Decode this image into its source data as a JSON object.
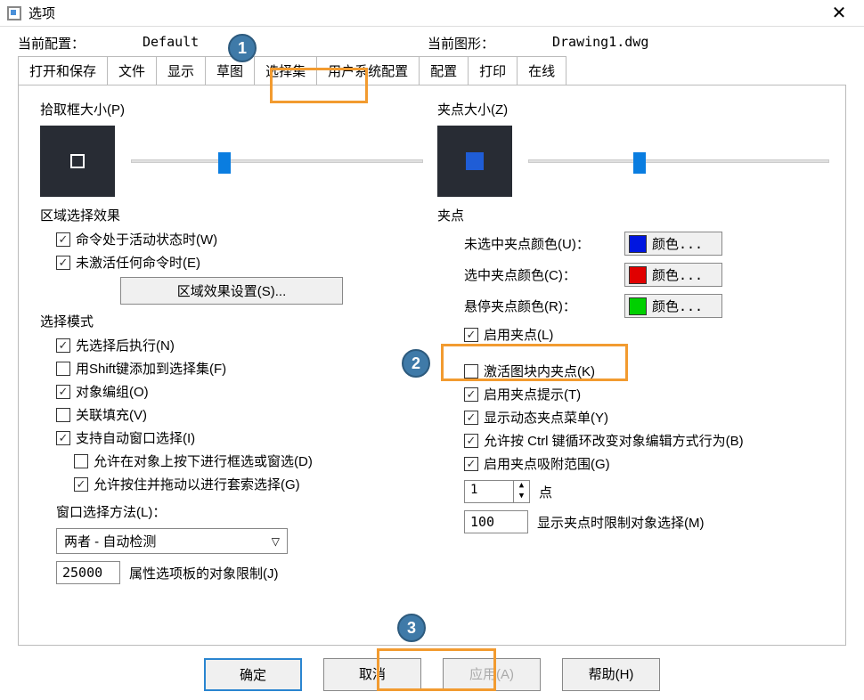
{
  "window": {
    "title": "选项",
    "close": "✕"
  },
  "config": {
    "label_current_config": "当前配置：",
    "current_config": "Default",
    "label_current_drawing": "当前图形：",
    "current_drawing": "Drawing1.dwg"
  },
  "tabs": [
    "打开和保存",
    "文件",
    "显示",
    "草图",
    "选择集",
    "用户系统配置",
    "配置",
    "打印",
    "在线"
  ],
  "callouts": {
    "c1": "1",
    "c2": "2",
    "c3": "3"
  },
  "left": {
    "pickbox_label": "拾取框大小(P)",
    "region_title": "区域选择效果",
    "region_chk1": "命令处于活动状态时(W)",
    "region_chk2": "未激活任何命令时(E)",
    "region_btn": "区域效果设置(S)...",
    "mode_title": "选择模式",
    "mode_chk1": "先选择后执行(N)",
    "mode_chk2": "用Shift键添加到选择集(F)",
    "mode_chk3": "对象编组(O)",
    "mode_chk4": "关联填充(V)",
    "mode_chk5": "支持自动窗口选择(I)",
    "mode_chk5a": "允许在对象上按下进行框选或窗选(D)",
    "mode_chk5b": "允许按住并拖动以进行套索选择(G)",
    "window_method_label": "窗口选择方法(L)：",
    "window_method_value": "两者 - 自动检测",
    "limit_value": "25000",
    "limit_label": "属性选项板的对象限制(J)"
  },
  "right": {
    "gripsize_label": "夹点大小(Z)",
    "grip_title": "夹点",
    "color_unsel_label": "未选中夹点颜色(U)：",
    "color_sel_label": "选中夹点颜色(C)：",
    "color_hover_label": "悬停夹点颜色(R)：",
    "color_btn": "颜色...",
    "colors": {
      "unsel": "#0016e0",
      "sel": "#e00000",
      "hover": "#00d000"
    },
    "g_chk1": "启用夹点(L)",
    "g_chk2": "激活图块内夹点(K)",
    "g_chk3": "启用夹点提示(T)",
    "g_chk4": "显示动态夹点菜单(Y)",
    "g_chk5": "允许按 Ctrl 键循环改变对象编辑方式行为(B)",
    "g_chk6": "启用夹点吸附范围(G)",
    "spin_value": "1",
    "spin_label": "点",
    "limit_value": "100",
    "limit_label": "显示夹点时限制对象选择(M)"
  },
  "buttons": {
    "ok": "确定",
    "cancel": "取消",
    "apply": "应用(A)",
    "help": "帮助(H)"
  }
}
